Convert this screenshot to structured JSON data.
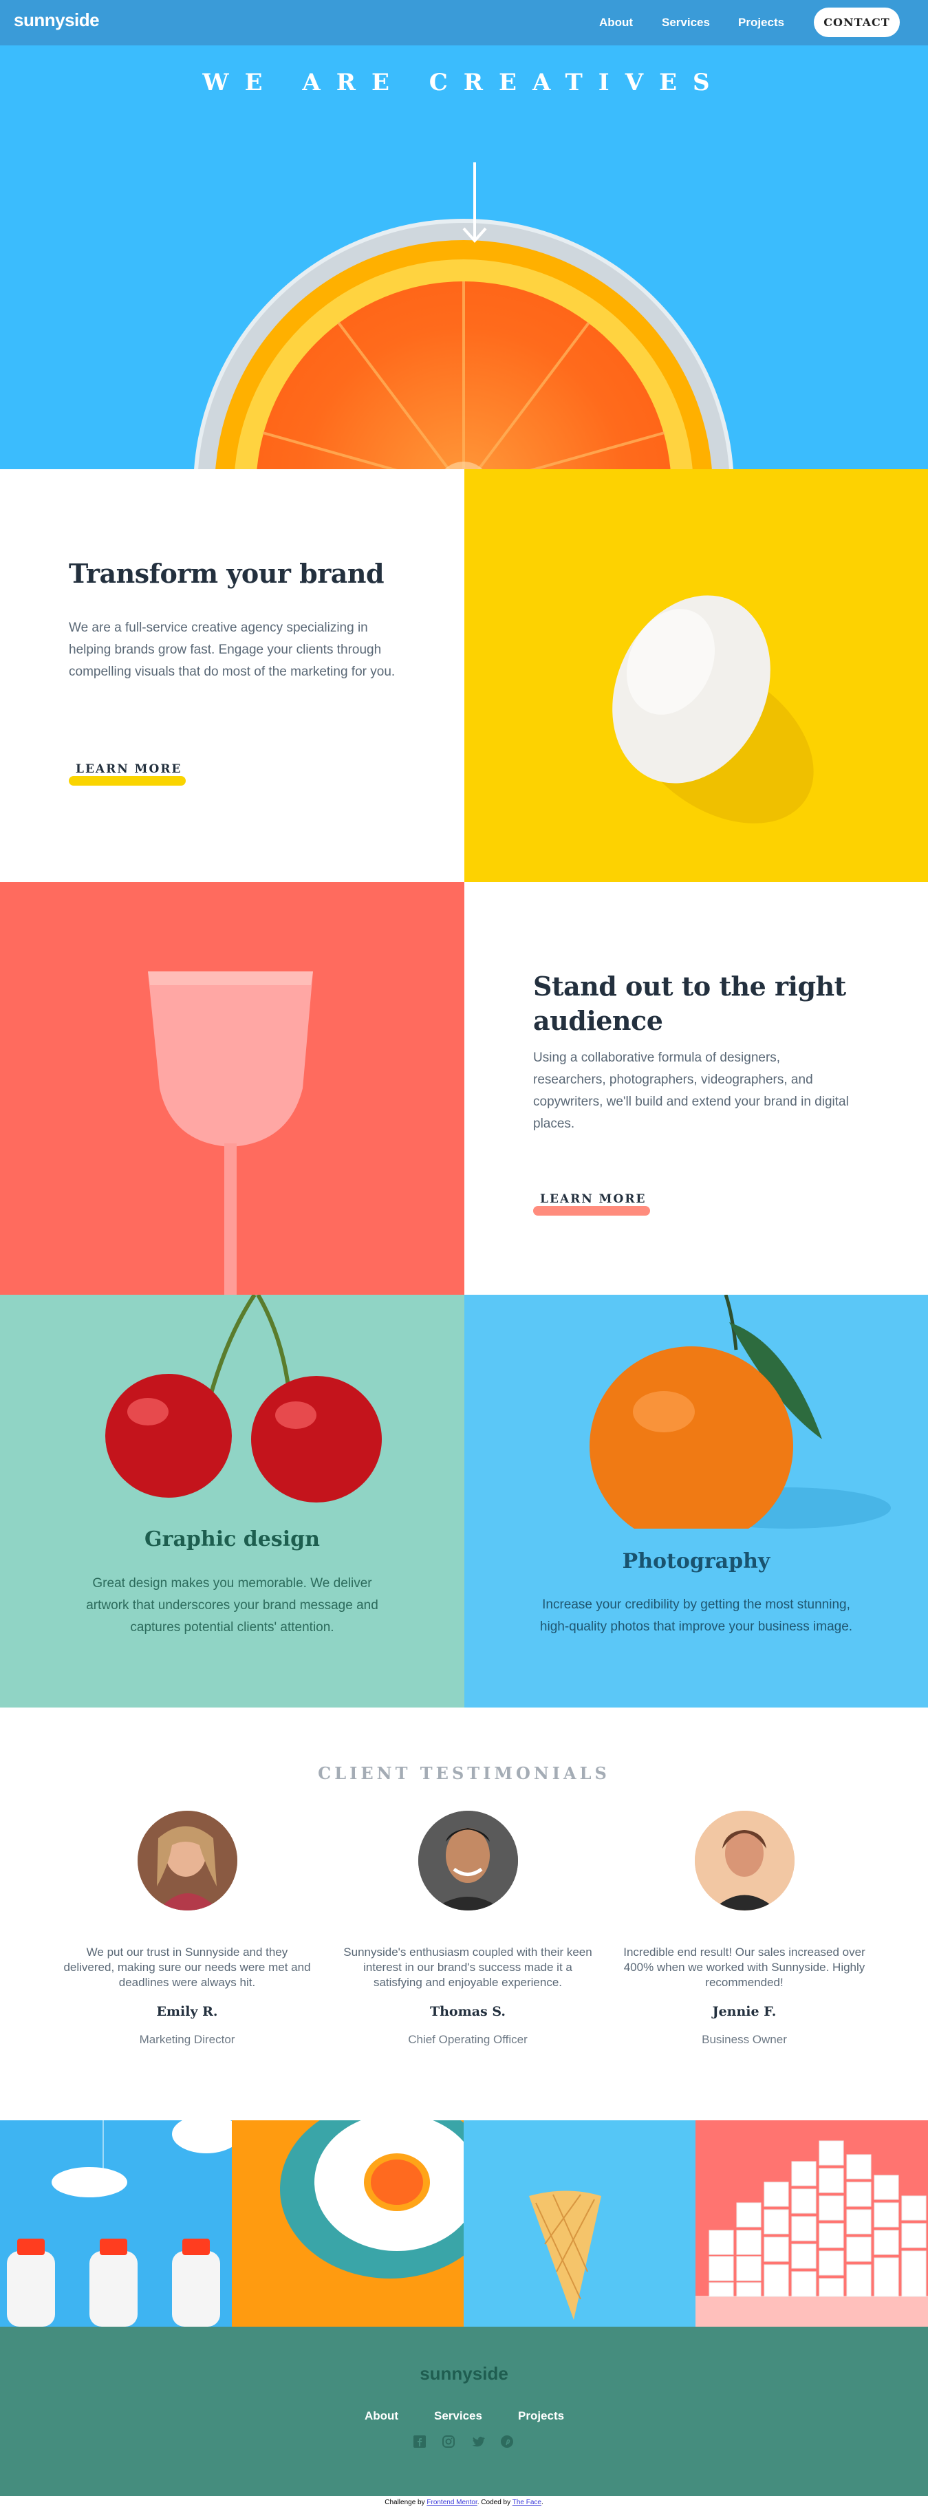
{
  "nav": {
    "logo": "sunnyside",
    "links": [
      "About",
      "Services",
      "Projects"
    ],
    "contact": "CONTACT"
  },
  "hero": {
    "title": "WE ARE CREATIVES"
  },
  "transform": {
    "title": "Transform your brand",
    "text": "We are a full-service creative agency specializing in helping brands grow fast. Engage your clients through compelling visuals that do most of the marketing for you.",
    "cta": "LEARN MORE"
  },
  "standout": {
    "title": "Stand out to the right audience",
    "text": "Using a collaborative formula of designers, researchers, photographers, videographers, and copywriters, we'll build and extend your brand in digital places.",
    "cta": "LEARN MORE"
  },
  "graphic": {
    "title": "Graphic design",
    "text": "Great design makes you memorable. We deliver artwork that underscores your brand message and captures potential clients' attention."
  },
  "photo": {
    "title": "Photography",
    "text": "Increase your credibility by getting the most stunning, high-quality photos that improve your business image."
  },
  "testimonials": {
    "heading": "CLIENT TESTIMONIALS",
    "items": [
      {
        "quote": "We put our trust in Sunnyside and they delivered, making sure our needs were met and deadlines were always hit.",
        "name": "Emily R.",
        "role": "Marketing Director"
      },
      {
        "quote": "Sunnyside's enthusiasm coupled with their keen interest in our brand's success made it a satisfying and enjoyable experience.",
        "name": "Thomas S.",
        "role": "Chief Operating Officer"
      },
      {
        "quote": "Incredible end result! Our sales increased over 400% when we worked with Sunnyside. Highly recommended!",
        "name": "Jennie F.",
        "role": "Business Owner"
      }
    ]
  },
  "footer": {
    "logo": "sunnyside",
    "links": [
      "About",
      "Services",
      "Projects"
    ],
    "icons": [
      "facebook-icon",
      "instagram-icon",
      "twitter-icon",
      "pinterest-icon"
    ]
  },
  "attribution": {
    "prefix": "Challenge by",
    "fm": "Frontend Mentor",
    "mid": ". Coded by",
    "coder": "The Face",
    "end": "."
  },
  "colors": {
    "nav": "#3a9bd8",
    "hero": "#3bbcfd",
    "yellow": "#fdd201",
    "coral": "#ff6b5e",
    "mint": "#90d4c5",
    "sky": "#5bc7f7",
    "footer": "#458d7e"
  }
}
